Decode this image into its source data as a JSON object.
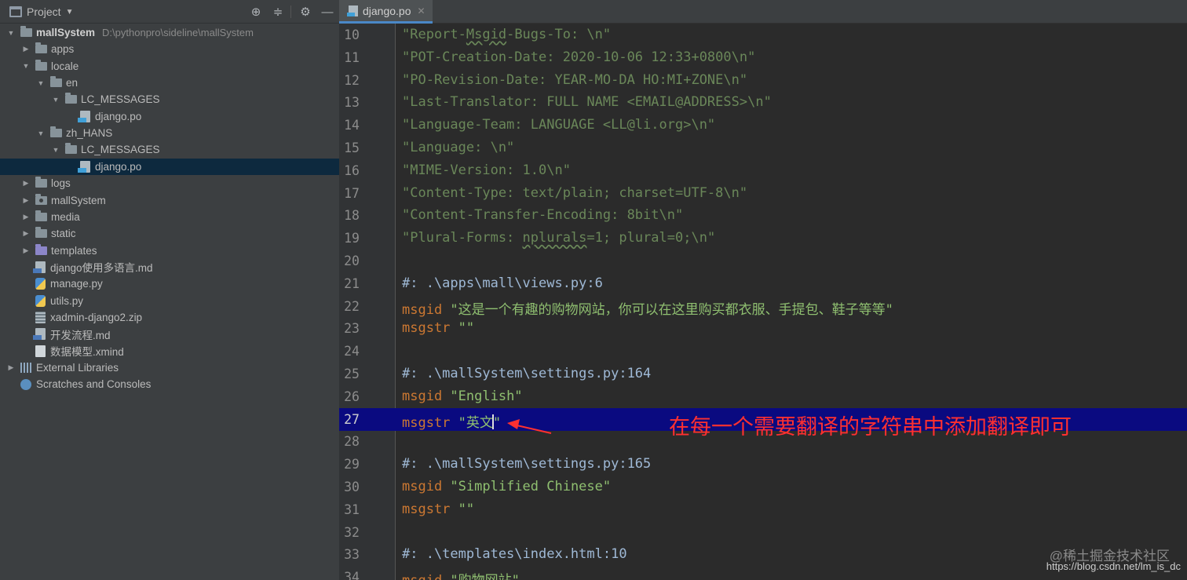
{
  "project_header": {
    "title": "Project"
  },
  "tree": [
    {
      "label": "mallSystem",
      "path": "D:\\pythonpro\\sideline\\mallSystem",
      "depth": 0,
      "expanded": true,
      "icon": "folder",
      "bold": true
    },
    {
      "label": "apps",
      "depth": 1,
      "expanded": false,
      "icon": "folder"
    },
    {
      "label": "locale",
      "depth": 1,
      "expanded": true,
      "icon": "folder"
    },
    {
      "label": "en",
      "depth": 2,
      "expanded": true,
      "icon": "folder"
    },
    {
      "label": "LC_MESSAGES",
      "depth": 3,
      "expanded": true,
      "icon": "folder"
    },
    {
      "label": "django.po",
      "depth": 4,
      "icon": "po-file"
    },
    {
      "label": "zh_HANS",
      "depth": 2,
      "expanded": true,
      "icon": "folder"
    },
    {
      "label": "LC_MESSAGES",
      "depth": 3,
      "expanded": true,
      "icon": "folder"
    },
    {
      "label": "django.po",
      "depth": 4,
      "icon": "po-file",
      "selected": true
    },
    {
      "label": "logs",
      "depth": 1,
      "expanded": false,
      "icon": "folder"
    },
    {
      "label": "mallSystem",
      "depth": 1,
      "expanded": false,
      "icon": "package-folder"
    },
    {
      "label": "media",
      "depth": 1,
      "expanded": false,
      "icon": "folder"
    },
    {
      "label": "static",
      "depth": 1,
      "expanded": false,
      "icon": "folder"
    },
    {
      "label": "templates",
      "depth": 1,
      "expanded": false,
      "icon": "templates-folder"
    },
    {
      "label": "django使用多语言.md",
      "depth": 1,
      "icon": "md-file"
    },
    {
      "label": "manage.py",
      "depth": 1,
      "icon": "py-file"
    },
    {
      "label": "utils.py",
      "depth": 1,
      "icon": "py-file"
    },
    {
      "label": "xadmin-django2.zip",
      "depth": 1,
      "icon": "zip-file"
    },
    {
      "label": "开发流程.md",
      "depth": 1,
      "icon": "md-file"
    },
    {
      "label": "数据模型.xmind",
      "depth": 1,
      "icon": "xmind-file"
    },
    {
      "label": "External Libraries",
      "depth": 0,
      "expanded": false,
      "icon": "libraries"
    },
    {
      "label": "Scratches and Consoles",
      "depth": 0,
      "icon": "scratches"
    }
  ],
  "editor": {
    "tab": {
      "label": "django.po"
    },
    "lines": [
      {
        "num": "10",
        "segments": [
          {
            "t": "\"Report-",
            "c": "str"
          },
          {
            "t": "Msgid",
            "c": "str-wavy"
          },
          {
            "t": "-Bugs-To: \\n\"",
            "c": "str"
          }
        ]
      },
      {
        "num": "11",
        "segments": [
          {
            "t": "\"POT-Creation-Date: 2020-10-06 12:33+0800\\n\"",
            "c": "str"
          }
        ]
      },
      {
        "num": "12",
        "segments": [
          {
            "t": "\"PO-Revision-Date: YEAR-MO-DA HO:MI+ZONE\\n\"",
            "c": "str"
          }
        ]
      },
      {
        "num": "13",
        "segments": [
          {
            "t": "\"Last-Translator: FULL NAME <EMAIL@ADDRESS>\\n\"",
            "c": "str"
          }
        ]
      },
      {
        "num": "14",
        "segments": [
          {
            "t": "\"Language-Team: LANGUAGE <LL@li.org>\\n\"",
            "c": "str"
          }
        ]
      },
      {
        "num": "15",
        "segments": [
          {
            "t": "\"Language: \\n\"",
            "c": "str"
          }
        ]
      },
      {
        "num": "16",
        "segments": [
          {
            "t": "\"MIME-Version: 1.0\\n\"",
            "c": "str"
          }
        ]
      },
      {
        "num": "17",
        "segments": [
          {
            "t": "\"Content-Type: text/plain; charset=UTF-8\\n\"",
            "c": "str"
          }
        ]
      },
      {
        "num": "18",
        "segments": [
          {
            "t": "\"Content-Transfer-Encoding: 8bit\\n\"",
            "c": "str"
          }
        ]
      },
      {
        "num": "19",
        "segments": [
          {
            "t": "\"Plural-Forms: ",
            "c": "str"
          },
          {
            "t": "nplurals",
            "c": "str-wavy"
          },
          {
            "t": "=1; plural=0;\\n\"",
            "c": "str"
          }
        ]
      },
      {
        "num": "20",
        "segments": []
      },
      {
        "num": "21",
        "segments": [
          {
            "t": "#: .\\apps\\mall\\views.py:6",
            "c": "cmt"
          }
        ]
      },
      {
        "num": "22",
        "segments": [
          {
            "t": "msgid ",
            "c": "kw"
          },
          {
            "t": "\"这是一个有趣的购物网站，你可以在这里购买都衣服、手提包、鞋子等等\"",
            "c": "str-light"
          }
        ]
      },
      {
        "num": "23",
        "segments": [
          {
            "t": "msgstr ",
            "c": "kw"
          },
          {
            "t": "\"\"",
            "c": "str-light"
          }
        ]
      },
      {
        "num": "24",
        "segments": []
      },
      {
        "num": "25",
        "segments": [
          {
            "t": "#: .\\mallSystem\\settings.py:164",
            "c": "cmt"
          }
        ]
      },
      {
        "num": "26",
        "segments": [
          {
            "t": "msgid ",
            "c": "kw"
          },
          {
            "t": "\"English\"",
            "c": "str-light"
          }
        ]
      },
      {
        "num": "27",
        "caret": true,
        "segments": [
          {
            "t": "msgstr ",
            "c": "kw"
          },
          {
            "t": "\"英文",
            "c": "str-light"
          },
          {
            "t": "",
            "c": "cursor"
          },
          {
            "t": "\"",
            "c": "str-light"
          }
        ]
      },
      {
        "num": "28",
        "segments": []
      },
      {
        "num": "29",
        "segments": [
          {
            "t": "#: .\\mallSystem\\settings.py:165",
            "c": "cmt"
          }
        ]
      },
      {
        "num": "30",
        "segments": [
          {
            "t": "msgid ",
            "c": "kw"
          },
          {
            "t": "\"Simplified Chinese\"",
            "c": "str-light"
          }
        ]
      },
      {
        "num": "31",
        "segments": [
          {
            "t": "msgstr ",
            "c": "kw"
          },
          {
            "t": "\"\"",
            "c": "str-light"
          }
        ]
      },
      {
        "num": "32",
        "segments": []
      },
      {
        "num": "33",
        "segments": [
          {
            "t": "#: .\\templates\\index.html:10",
            "c": "cmt"
          }
        ]
      },
      {
        "num": "34",
        "segments": [
          {
            "t": "msgid ",
            "c": "kw"
          },
          {
            "t": "\"购物网站\"",
            "c": "str-light"
          }
        ]
      }
    ]
  },
  "annotation": {
    "text": "在每一个需要翻译的字符串中添加翻译即可",
    "color": "#ff3030"
  },
  "watermark": {
    "line1": "@稀土掘金技术社区",
    "line2": "https://blog.csdn.net/lm_is_dc"
  },
  "colors": {
    "caret_line": "#0a0a80",
    "selected_row": "#0d293e",
    "keyword": "#cc7832",
    "string": "#6a8759",
    "comment": "#9fb9d6"
  }
}
